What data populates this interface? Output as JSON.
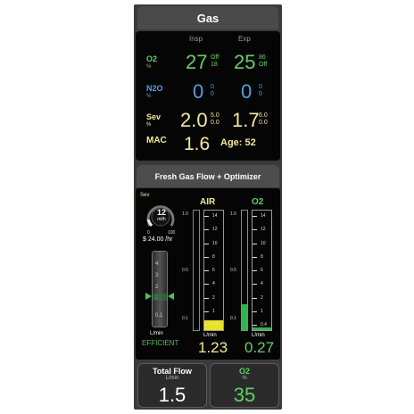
{
  "gas": {
    "title": "Gas",
    "col_insp": "Insp",
    "col_exp": "Exp",
    "o2": {
      "label": "O2",
      "unit": "%",
      "insp": "27",
      "insp_sub1": "Off",
      "insp_sub2": "18",
      "exp": "25",
      "exp_sub1": "86",
      "exp_sub2": "Off"
    },
    "n2o": {
      "label": "N2O",
      "unit": "%",
      "insp": "0",
      "insp_sub1": "0",
      "insp_sub2": "0",
      "exp": "0",
      "exp_sub1": "0",
      "exp_sub2": "0"
    },
    "sev": {
      "label": "Sev",
      "unit": "%",
      "insp": "2.0",
      "insp_sub1": "5.0",
      "insp_sub2": "0.0",
      "exp": "1.7",
      "exp_sub1": "6.0",
      "exp_sub2": "0.0"
    },
    "mac": {
      "label": "MAC",
      "value": "1.6",
      "age": "Age: 52"
    }
  },
  "fgf": {
    "title": "Fresh Gas Flow + Optimizer",
    "agent_label": "Sev",
    "gauge": {
      "value": "12",
      "unit": "ml/h",
      "min": "0",
      "max": "100",
      "cost": "$ 24.00 /hr",
      "level": 0.12
    },
    "optimizer": {
      "scale": [
        "4",
        "3",
        "2",
        "1",
        "0.1"
      ],
      "unit": "L/min",
      "status": "EFFICIENT"
    },
    "air": {
      "title": "AIR",
      "unit": "L/min",
      "value": "1.23",
      "tube_labels": [
        "14",
        "12",
        "10",
        "8",
        "6",
        "4",
        "2",
        "1",
        "0.4"
      ],
      "side_scale": [
        "1.0",
        "0.5",
        "0.1"
      ],
      "fill_level": 0.08
    },
    "o2": {
      "title": "O2",
      "unit": "L/min",
      "value": "0.27",
      "tube_labels": [
        "14",
        "12",
        "10",
        "8",
        "6",
        "4",
        "2",
        "1",
        "0.4"
      ],
      "side_scale": [
        "1.0",
        "0.5",
        "0.1"
      ],
      "fill_level": 0.02,
      "thin_fill_level": 0.22
    }
  },
  "bottom": {
    "total_flow": {
      "title": "Total Flow",
      "unit": "L/min",
      "value": "1.5"
    },
    "o2": {
      "title": "O2",
      "unit": "%",
      "value": "35"
    }
  },
  "colors": {
    "green": "#5fd35f",
    "blue": "#4aa4e6",
    "yellow": "#f4eb8a",
    "air_fill": "#ece21a",
    "o2_fill": "#2fb64a"
  }
}
